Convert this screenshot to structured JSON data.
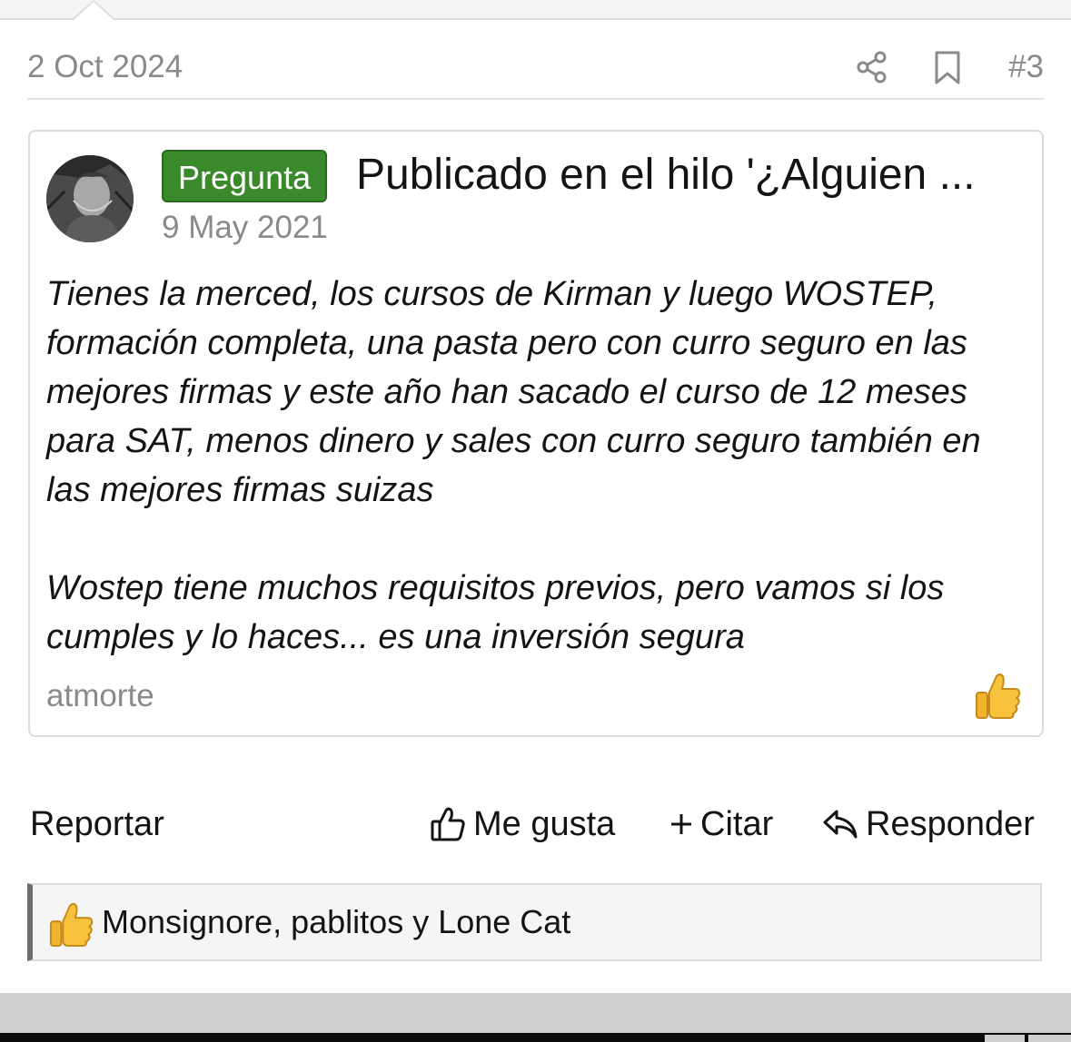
{
  "post": {
    "date": "2 Oct 2024",
    "number": "#3"
  },
  "quote": {
    "badge": "Pregunta",
    "title": "Publicado en el hilo '¿Alguien ...",
    "date": "9 May 2021",
    "paragraphs": [
      "Tienes la merced, los cursos de Kirman y luego WOSTEP, formación completa, una pasta pero con curro seguro en las mejores firmas y este año han sacado el curso de 12 meses para SAT, menos dinero y sales con curro seguro también en las mejores firmas suizas",
      "Wostep tiene muchos requisitos previos, pero vamos si los cumples y lo haces... es una inversión segura"
    ],
    "author": "atmorte",
    "reaction_icon": "thumbs-up-emoji"
  },
  "actions": {
    "report": "Reportar",
    "like": "Me gusta",
    "quote": "Citar",
    "reply": "Responder"
  },
  "likes": {
    "icon": "thumbs-up-emoji",
    "text": "Monsignore, pablitos y Lone Cat"
  },
  "colors": {
    "badge_bg": "#3a8a2b",
    "muted_text": "#8a8a8a",
    "border": "#dcdcdc"
  }
}
